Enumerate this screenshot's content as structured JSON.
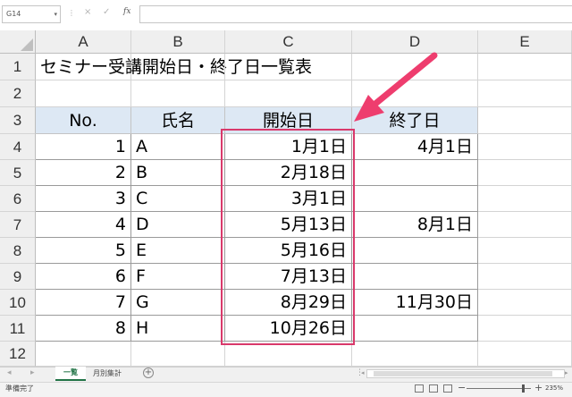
{
  "formula_bar": {
    "name_box": "G14",
    "cancel_icon": "×",
    "enter_icon": "✓",
    "fx_label": "fx",
    "formula": ""
  },
  "columns": [
    "A",
    "B",
    "C",
    "D",
    "E"
  ],
  "rows": [
    "1",
    "2",
    "3",
    "4",
    "5",
    "6",
    "7",
    "8",
    "9",
    "10",
    "11",
    "12"
  ],
  "sheet": {
    "title": "セミナー受講開始日・終了日一覧表",
    "headers": [
      "No.",
      "氏名",
      "開始日",
      "終了日"
    ],
    "records": [
      {
        "no": "1",
        "name": "A",
        "start": "1月1日",
        "end": "4月1日"
      },
      {
        "no": "2",
        "name": "B",
        "start": "2月18日",
        "end": ""
      },
      {
        "no": "3",
        "name": "C",
        "start": "3月1日",
        "end": ""
      },
      {
        "no": "4",
        "name": "D",
        "start": "5月13日",
        "end": "8月1日"
      },
      {
        "no": "5",
        "name": "E",
        "start": "5月16日",
        "end": ""
      },
      {
        "no": "6",
        "name": "F",
        "start": "7月13日",
        "end": ""
      },
      {
        "no": "7",
        "name": "G",
        "start": "8月29日",
        "end": "11月30日"
      },
      {
        "no": "8",
        "name": "H",
        "start": "10月26日",
        "end": ""
      }
    ]
  },
  "tabs": {
    "active": "一覧",
    "other": "月別集計",
    "add_icon": "+"
  },
  "status": {
    "text": "準備完了",
    "zoom": "235%"
  },
  "colors": {
    "header_fill": "#dde8f4",
    "highlight_box": "#d9396b",
    "arrow": "#ee3d6e",
    "tab_accent": "#217346"
  }
}
